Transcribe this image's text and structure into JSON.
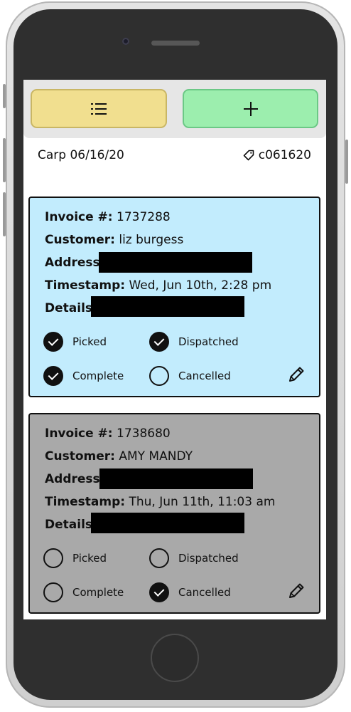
{
  "toolbar": {
    "list_icon": "list-icon",
    "add_icon": "plus-icon"
  },
  "header": {
    "title": "Carp 06/16/20",
    "tag_icon": "tag-icon",
    "tag": "c061620"
  },
  "labels": {
    "invoice": "Invoice #:",
    "customer": "Customer:",
    "address": "Address:",
    "timestamp": "Timestamp:",
    "details": "Details:",
    "picked": "Picked",
    "dispatched": "Dispatched",
    "complete": "Complete",
    "cancelled": "Cancelled"
  },
  "orders": [
    {
      "invoice": "1737288",
      "customer": "liz burgess",
      "timestamp": "Wed, Jun 10th, 2:28 pm",
      "background": "#c2ecfd",
      "picked": true,
      "dispatched": true,
      "complete": true,
      "cancelled": false
    },
    {
      "invoice": "1738680",
      "customer": "AMY MANDY",
      "timestamp": "Thu, Jun 11th, 11:03 am",
      "background": "#a9a9a9",
      "picked": false,
      "dispatched": false,
      "complete": false,
      "cancelled": true
    }
  ],
  "colors": {
    "list_button": "#f1df8f",
    "add_button": "#9ceeae"
  }
}
